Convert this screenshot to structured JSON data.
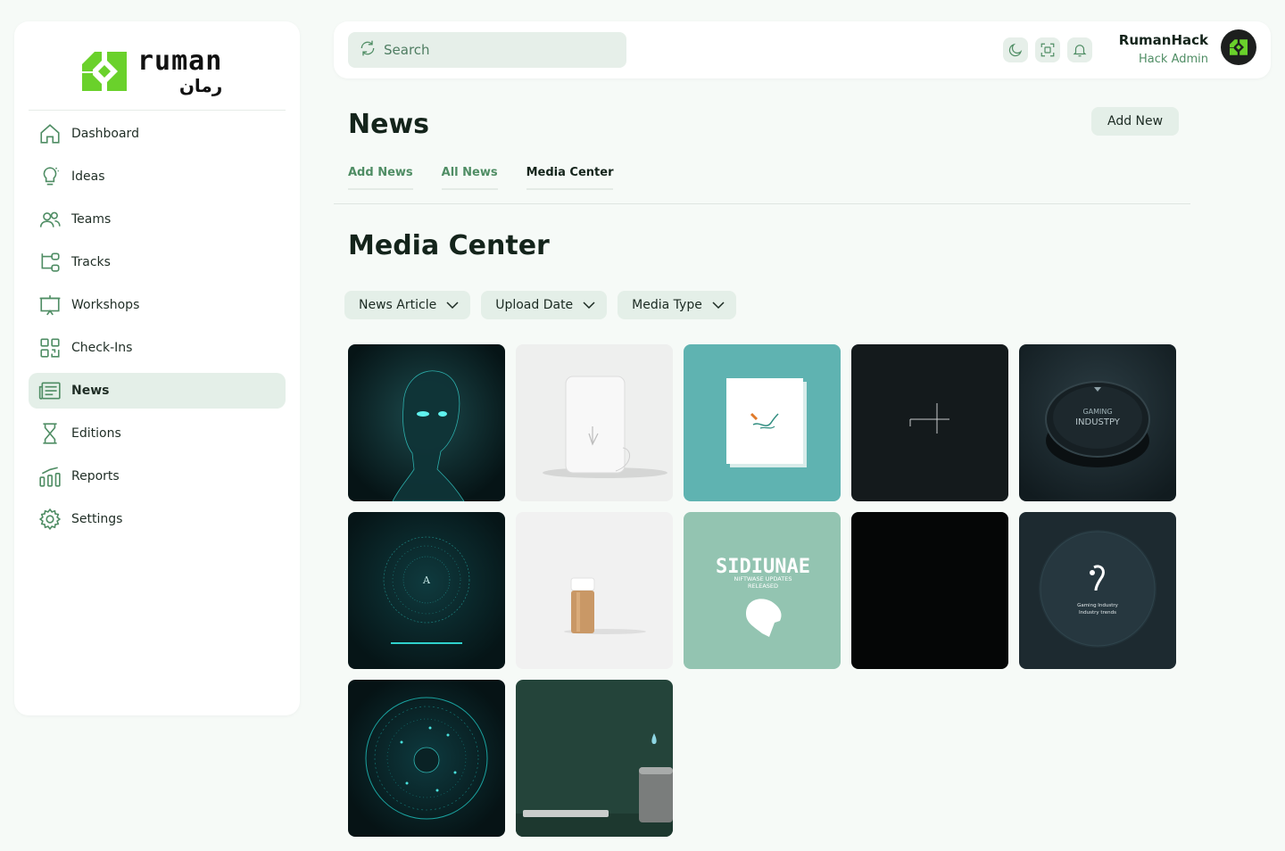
{
  "brand": {
    "name_en": "ruman",
    "name_ar": "رمان",
    "accent": "#6ad12b"
  },
  "sidebar": {
    "items": [
      {
        "label": "Dashboard",
        "icon": "home-icon"
      },
      {
        "label": "Ideas",
        "icon": "lightbulb-icon"
      },
      {
        "label": "Teams",
        "icon": "users-icon"
      },
      {
        "label": "Tracks",
        "icon": "tracks-icon"
      },
      {
        "label": "Workshops",
        "icon": "presentation-icon"
      },
      {
        "label": "Check-Ins",
        "icon": "qr-code-icon"
      },
      {
        "label": "News",
        "icon": "newspaper-icon",
        "active": true
      },
      {
        "label": "Editions",
        "icon": "hourglass-icon"
      },
      {
        "label": "Reports",
        "icon": "chart-icon"
      },
      {
        "label": "Settings",
        "icon": "gear-icon"
      }
    ]
  },
  "topbar": {
    "search_placeholder": "Search",
    "icons": [
      "moon-icon",
      "scan-icon",
      "bell-icon"
    ],
    "user": {
      "name": "RumanHack",
      "role": "Hack Admin"
    }
  },
  "page": {
    "title": "News",
    "add_new_label": "Add New",
    "tabs": [
      {
        "label": "Add News"
      },
      {
        "label": "All News"
      },
      {
        "label": "Media Center",
        "active": true
      }
    ],
    "section_title": "Media Center",
    "filters": [
      {
        "label": "News Article"
      },
      {
        "label": "Upload Date"
      },
      {
        "label": "Media Type"
      }
    ]
  },
  "media": {
    "tiles": [
      {
        "subject": "ai-face"
      },
      {
        "subject": "white-device"
      },
      {
        "subject": "paper-card"
      },
      {
        "subject": "dark-line"
      },
      {
        "subject": "gaming-button",
        "text": "GAMING INDUSTPY"
      },
      {
        "subject": "circuit-disc"
      },
      {
        "subject": "wood-bottle"
      },
      {
        "subject": "software-poster",
        "text": "SIDIUNAE",
        "subtext": "NIFTWASE UPDATES RELEASED"
      },
      {
        "subject": "black"
      },
      {
        "subject": "dark-circle",
        "text": "Gaming Industry Industry trends"
      },
      {
        "subject": "neural-sphere"
      },
      {
        "subject": "green-room"
      }
    ]
  }
}
